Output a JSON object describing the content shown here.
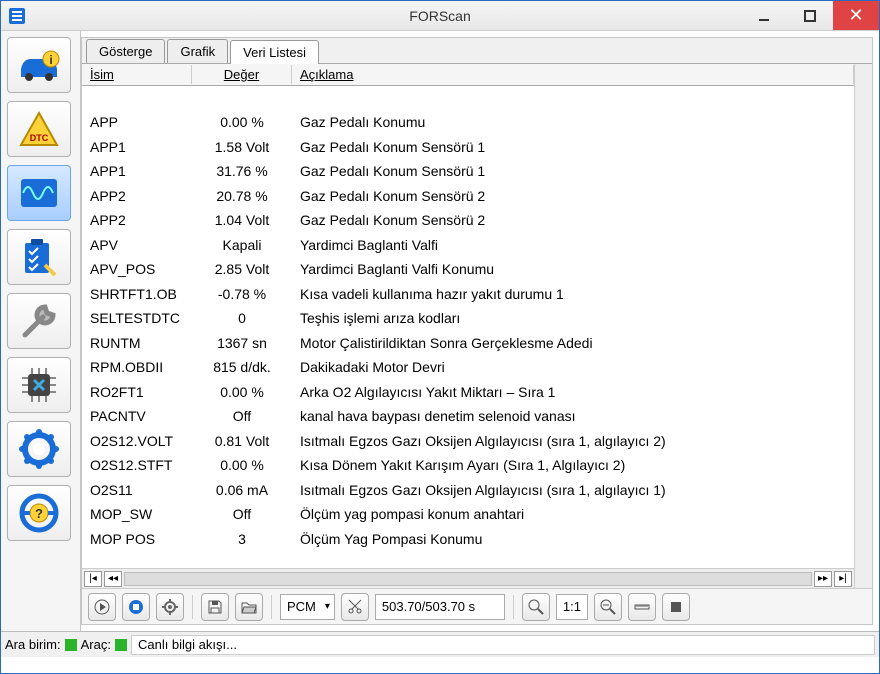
{
  "window": {
    "title": "FORScan"
  },
  "tabs": [
    {
      "label": "Gösterge"
    },
    {
      "label": "Grafik"
    },
    {
      "label": "Veri Listesi"
    }
  ],
  "columns": {
    "name": "İsim",
    "value": "Değer",
    "desc": "Açıklama"
  },
  "rows": [
    {
      "name": "",
      "value": "",
      "desc": ""
    },
    {
      "name": "APP",
      "value": "0.00 %",
      "desc": "Gaz Pedalı Konumu"
    },
    {
      "name": "APP1",
      "value": "1.58 Volt",
      "desc": "Gaz Pedalı Konum Sensörü 1"
    },
    {
      "name": "APP1",
      "value": "31.76 %",
      "desc": "Gaz Pedalı Konum Sensörü 1"
    },
    {
      "name": "APP2",
      "value": "20.78 %",
      "desc": "Gaz Pedalı Konum Sensörü 2"
    },
    {
      "name": "APP2",
      "value": "1.04 Volt",
      "desc": "Gaz Pedalı Konum Sensörü 2"
    },
    {
      "name": "APV",
      "value": "Kapali",
      "desc": "Yardimci Baglanti Valfi"
    },
    {
      "name": "APV_POS",
      "value": "2.85 Volt",
      "desc": "Yardimci Baglanti Valfi Konumu"
    },
    {
      "name": "SHRTFT1.OB",
      "value": "-0.78 %",
      "desc": "Kısa vadeli kullanıma hazır yakıt durumu 1"
    },
    {
      "name": "SELTESTDTC",
      "value": "0",
      "desc": "Teşhis işlemi arıza kodları"
    },
    {
      "name": "RUNTM",
      "value": "1367 sn",
      "desc": "Motor Çalistirildiktan Sonra Gerçeklesme Adedi"
    },
    {
      "name": "RPM.OBDII",
      "value": "815 d/dk.",
      "desc": "Dakikadaki Motor Devri"
    },
    {
      "name": "RO2FT1",
      "value": "0.00 %",
      "desc": "Arka O2 Algılayıcısı Yakıt Miktarı – Sıra 1"
    },
    {
      "name": "PACNTV",
      "value": "Off",
      "desc": "kanal hava baypası denetim selenoid vanası"
    },
    {
      "name": "O2S12.VOLT",
      "value": "0.81 Volt",
      "desc": "Isıtmalı Egzos Gazı Oksijen Algılayıcısı (sıra 1, algılayıcı 2)"
    },
    {
      "name": "O2S12.STFT",
      "value": "0.00 %",
      "desc": "Kısa Dönem Yakıt Karışım Ayarı (Sıra 1, Algılayıcı 2)"
    },
    {
      "name": "O2S11",
      "value": "0.06 mA",
      "desc": "Isıtmalı Egzos Gazı Oksijen Algılayıcısı (sıra 1, algılayıcı 1)"
    },
    {
      "name": "MOP_SW",
      "value": "Off",
      "desc": "Ölçüm yag pompasi konum anahtari"
    },
    {
      "name": "MOP POS",
      "value": "3",
      "desc": "Ölçüm Yag Pompasi Konumu"
    }
  ],
  "toolbar": {
    "module": "PCM",
    "time": "503.70/503.70 s",
    "ratio": "1:1"
  },
  "status": {
    "label1": "Ara birim:",
    "label2": "Araç:",
    "msg": "Canlı bilgi akışı..."
  }
}
